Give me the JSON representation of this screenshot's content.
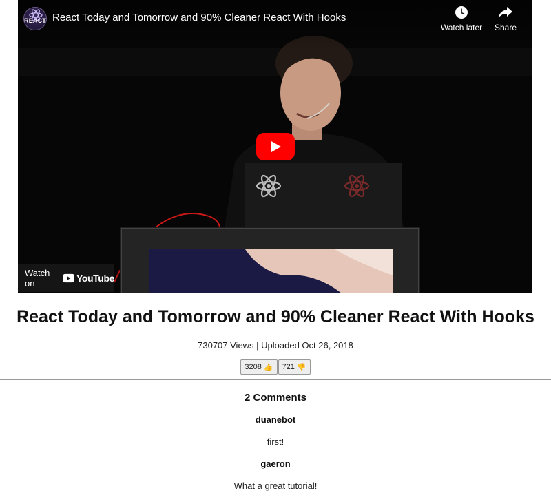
{
  "player": {
    "title": "React Today and Tomorrow and 90% Cleaner React With Hooks",
    "channel_avatar_text": "REACT",
    "watch_later_label": "Watch later",
    "share_label": "Share",
    "watch_on_label": "Watch on",
    "youtube_word": "YouTube",
    "icons": {
      "watch_later": "clock-icon",
      "share": "share-arrow-icon",
      "play": "play-icon",
      "youtube": "youtube-logo-icon"
    },
    "colors": {
      "play_red": "#ff0000",
      "bar_bg": "#191919"
    }
  },
  "video": {
    "title": "React Today and Tomorrow and 90% Cleaner React With Hooks",
    "views_text": "730707 Views | Uploaded Oct 26, 2018",
    "likes": "3208",
    "like_emoji": "👍",
    "dislikes": "721",
    "dislike_emoji": "👎"
  },
  "comments": {
    "heading": "2 Comments",
    "items": [
      {
        "author": "duanebot",
        "text": "first!"
      },
      {
        "author": "gaeron",
        "text": "What a great tutorial!"
      }
    ]
  }
}
